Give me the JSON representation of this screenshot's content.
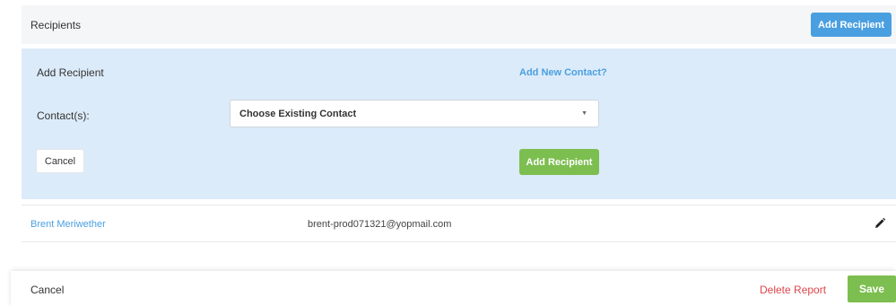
{
  "header": {
    "title": "Recipients",
    "add_button": "Add Recipient"
  },
  "panel": {
    "title": "Add Recipient",
    "new_contact_link": "Add New Contact?",
    "contacts_label": "Contact(s):",
    "contacts_select_value": "Choose Existing Contact",
    "cancel_label": "Cancel",
    "add_label": "Add Recipient"
  },
  "recipients": [
    {
      "name": "Brent Meriwether",
      "email": "brent-prod071321@yopmail.com"
    }
  ],
  "footer": {
    "cancel_label": "Cancel",
    "delete_label": "Delete Report",
    "save_label": "Save"
  },
  "colors": {
    "accent_blue": "#4a9fe0",
    "accent_green": "#7cbe4f",
    "danger_red": "#e0454b",
    "panel_bg": "#dcebfa"
  }
}
